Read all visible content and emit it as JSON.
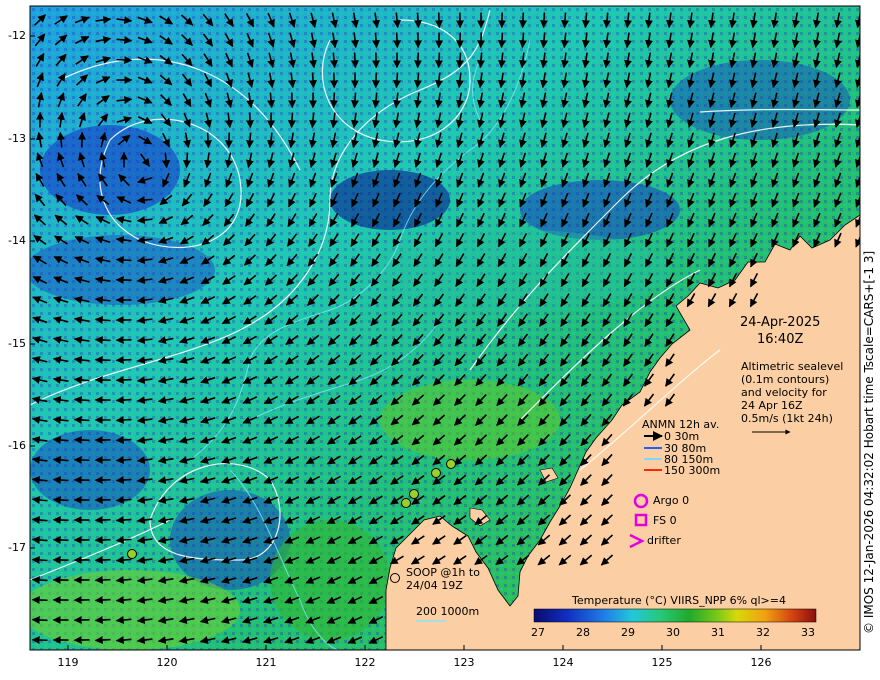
{
  "map": {
    "y_ticks": [
      "-12",
      "-13",
      "-14",
      "-15",
      "-16",
      "-17"
    ],
    "x_ticks": [
      "119",
      "120",
      "121",
      "122",
      "123",
      "124",
      "125",
      "126"
    ],
    "date": "24-Apr-2025",
    "time": "16:40Z",
    "description_lines": [
      "Altimetric sealevel",
      "(0.1m contours)",
      "and velocity for",
      "24 Apr 16Z",
      "0.5m/s (1kt 24h)"
    ],
    "anmn": {
      "title": "ANMN 12h av.",
      "items": [
        {
          "label": "0 30m",
          "color": "#000000"
        },
        {
          "label": "30 80m",
          "color": "#1f5fff"
        },
        {
          "label": "80 150m",
          "color": "#7fd8ff"
        },
        {
          "label": "150 300m",
          "color": "#ff2a00"
        }
      ]
    },
    "argo_label": "Argo 0",
    "fs_label": "FS 0",
    "drifter_label": "drifter",
    "soop_lines": [
      "SOOP @1h to",
      "24/04 19Z"
    ],
    "bathy_label": "200  1000m",
    "colorbar": {
      "title": "Temperature (°C) VIIRS_NPP 6% ql>=4",
      "ticks": [
        "27",
        "28",
        "29",
        "30",
        "31",
        "32",
        "33"
      ],
      "colors": [
        "#0a0a70",
        "#1030c0",
        "#1f7fe8",
        "#22c8d8",
        "#28c878",
        "#1faa2a",
        "#7ac818",
        "#d8d80a",
        "#f0a010",
        "#d04010",
        "#8a1010"
      ]
    },
    "credit": "© IMOS 12-Jan-2026 04:32:02 Hobart time Tscale=CARS+[-1 3]",
    "colors": {
      "land": "#fbcfa3",
      "sea_mid": "#1fbf4a"
    }
  }
}
